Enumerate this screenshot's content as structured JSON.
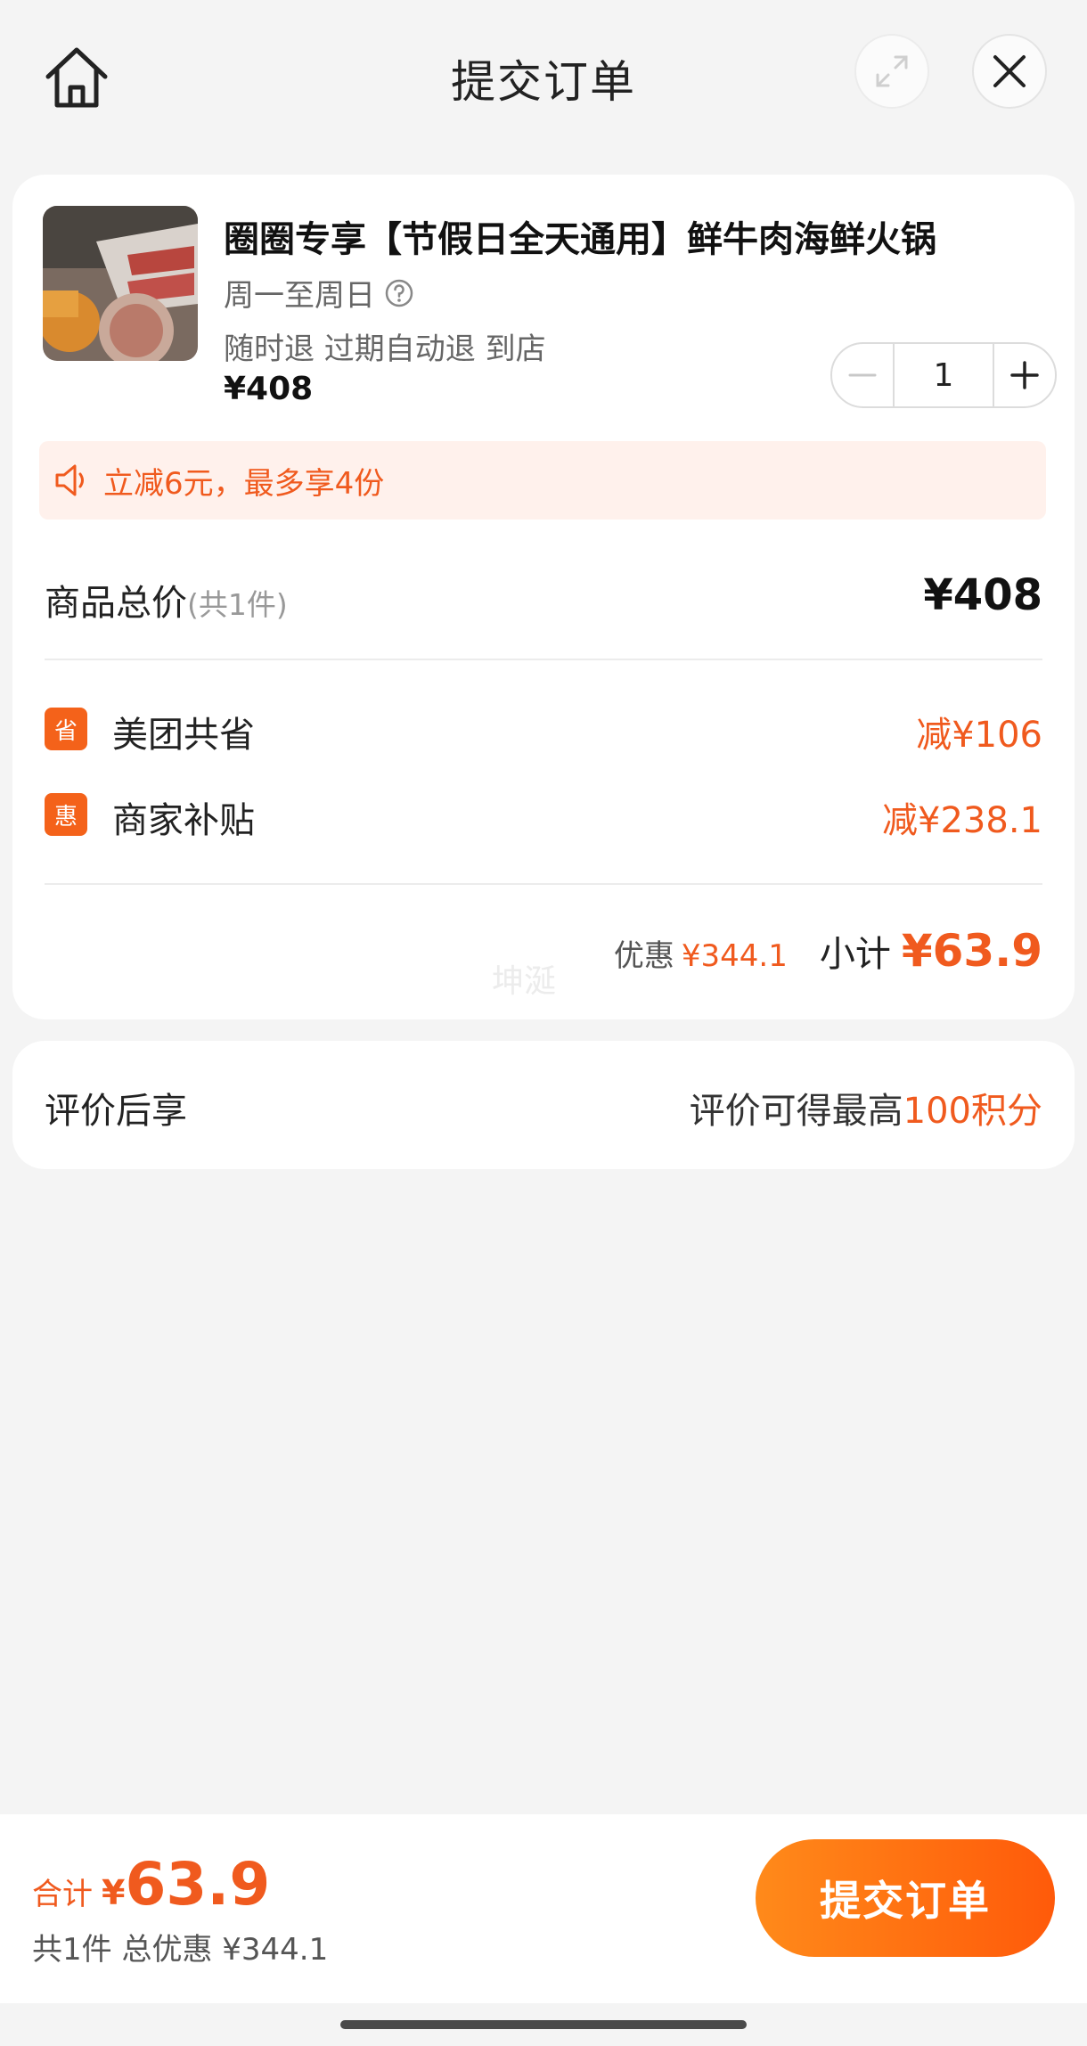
{
  "header": {
    "title": "提交订单"
  },
  "product": {
    "title": "圈圈专享【节假日全天通用】鲜牛肉海鲜火锅",
    "days": "周一至周日",
    "tags": "随时退 过期自动退 到店",
    "price": "¥408",
    "quantity": "1"
  },
  "promo": {
    "text": "立减6元，最多享4份"
  },
  "summary": {
    "total_label": "商品总价",
    "total_count": "(共1件)",
    "total_value": "¥408",
    "discounts": [
      {
        "badge": "省",
        "label": "美团共省",
        "value": "减¥106"
      },
      {
        "badge": "惠",
        "label": "商家补贴",
        "value": "减¥238.1"
      }
    ],
    "save_label": "优惠",
    "save_value": "¥344.1",
    "subtotal_label": "小计",
    "subtotal_value": "¥63.9",
    "watermark": "坤涎"
  },
  "review": {
    "label": "评价后享",
    "text": "评价可得最高",
    "points": "100积分"
  },
  "bottom": {
    "sum_label": "合计",
    "sum_currency": "¥",
    "sum_value": "63.9",
    "sub_text": "共1件 总优惠 ¥344.1",
    "submit_label": "提交订单"
  },
  "colors": {
    "accent": "#f05a1e",
    "badge": "#f4621a",
    "promo_bg": "#fff1ec",
    "page_bg": "#f4f4f4"
  },
  "icons": [
    "home-icon",
    "expand-icon",
    "close-icon",
    "help-icon",
    "minus-icon",
    "plus-icon",
    "speaker-icon"
  ]
}
